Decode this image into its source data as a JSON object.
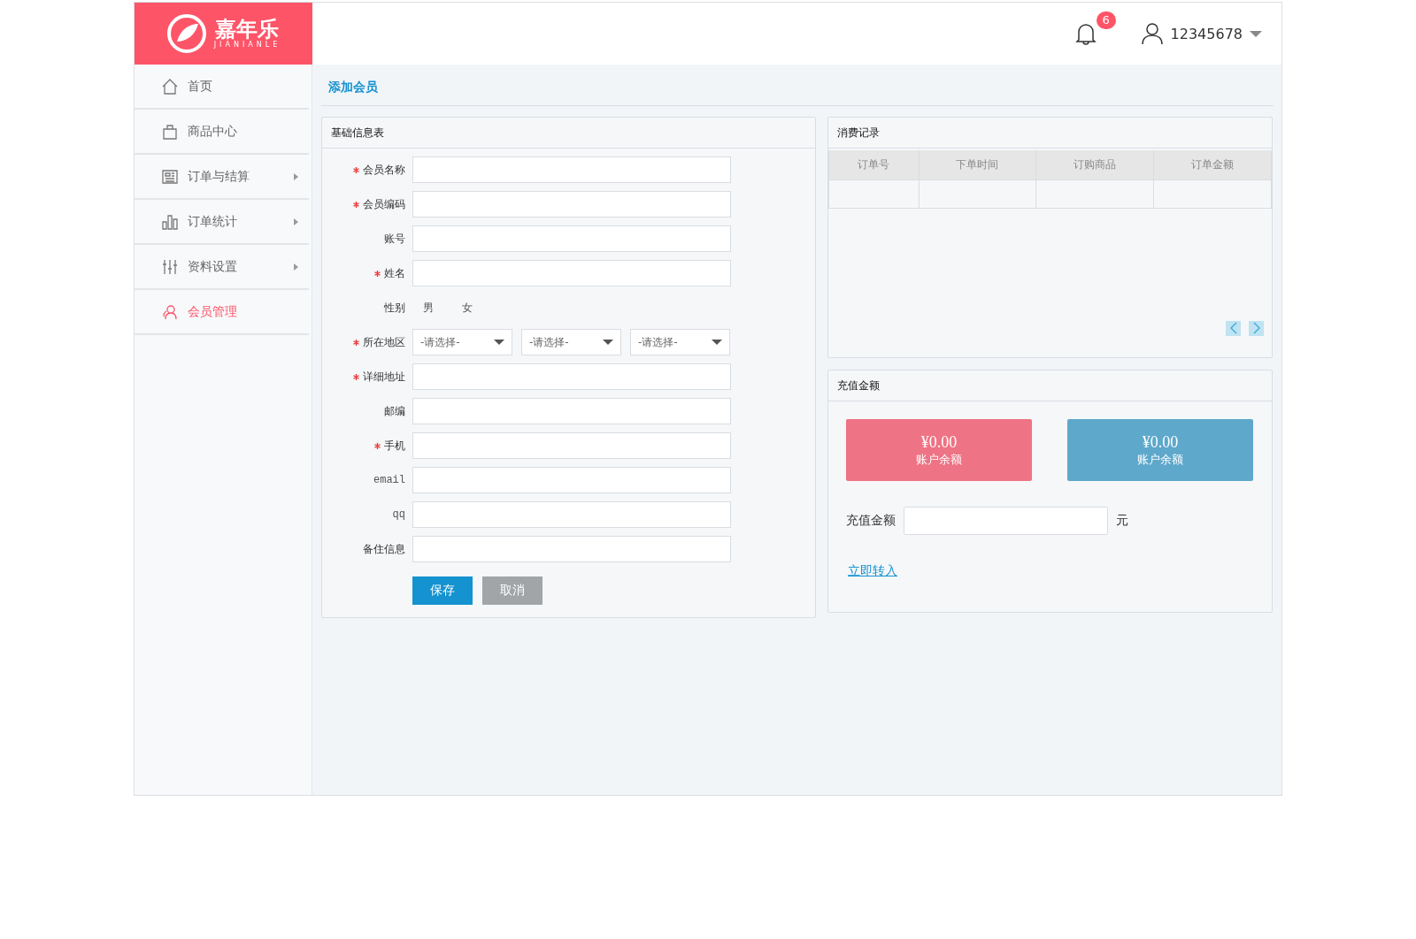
{
  "logo": {
    "name": "嘉年乐",
    "subtitle": "JIANIANLE"
  },
  "header": {
    "notification_count": "6",
    "username": "12345678"
  },
  "sidebar": {
    "items": [
      {
        "label": "首页",
        "expandable": false,
        "selected": false
      },
      {
        "label": "商品中心",
        "expandable": false,
        "selected": false
      },
      {
        "label": "订单与结算",
        "expandable": true,
        "selected": false
      },
      {
        "label": "订单统计",
        "expandable": true,
        "selected": false
      },
      {
        "label": "资料设置",
        "expandable": true,
        "selected": false
      },
      {
        "label": "会员管理",
        "expandable": false,
        "selected": true
      }
    ]
  },
  "breadcrumb": "添加会员",
  "form": {
    "title": "基础信息表",
    "fields": [
      {
        "kind": "text",
        "label": "会员名称",
        "required": true
      },
      {
        "kind": "text",
        "label": "会员编码",
        "required": true
      },
      {
        "kind": "text",
        "label": "账号",
        "required": false
      },
      {
        "kind": "text",
        "label": "姓名",
        "required": true
      },
      {
        "kind": "options",
        "label": "性别",
        "required": false,
        "options": [
          "男",
          "女"
        ]
      },
      {
        "kind": "select",
        "label": "所在地区",
        "required": true,
        "values": [
          "-请选择-",
          "-请选择-",
          "-请选择-"
        ]
      },
      {
        "kind": "text",
        "label": "详细地址",
        "required": true
      },
      {
        "kind": "text",
        "label": "邮编",
        "required": false
      },
      {
        "kind": "text",
        "label": "手机",
        "required": true
      },
      {
        "kind": "text",
        "label": "email",
        "required": false
      },
      {
        "kind": "text",
        "label": "qq",
        "required": false
      },
      {
        "kind": "text",
        "label": "备住信息",
        "required": false
      }
    ],
    "buttons": [
      {
        "kind": "primary",
        "label": "保存"
      },
      {
        "kind": "secondary",
        "label": "取消"
      }
    ]
  },
  "records": {
    "title": "消费记录",
    "table": {
      "columns": [
        "订单号",
        "下单时间",
        "订购商品",
        "订单金额"
      ]
    }
  },
  "recharge": {
    "title": "充值金额",
    "cards": [
      {
        "amount": "¥0.00",
        "label": "账户余额",
        "color": "#ee7384"
      },
      {
        "amount": "¥0.00",
        "label": "账户余额",
        "color": "#5ea8cb"
      }
    ],
    "amount_label": "充值金额",
    "unit": "元",
    "link": "立即转入"
  }
}
